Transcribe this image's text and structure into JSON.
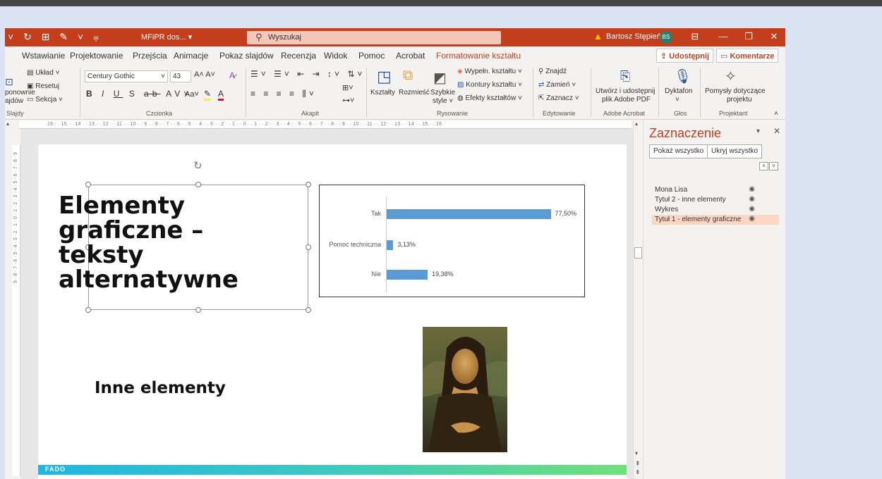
{
  "titlebar": {
    "doc_name": "MFiPR dos... ▾",
    "search_placeholder": "Wyszukaj",
    "user_name": "Bartosz Stępień",
    "avatar_initials": "BS"
  },
  "menu": {
    "items": [
      "Wstawianie",
      "Projektowanie",
      "Przejścia",
      "Animacje",
      "Pokaz slajdów",
      "Recenzja",
      "Widok",
      "Pomoc",
      "Acrobat",
      "Formatowanie kształtu"
    ],
    "share": "Udostępnij",
    "comments": "Komentarze"
  },
  "ribbon": {
    "slides": {
      "layout": "Układ ˅",
      "reset": "Resetuj",
      "section": "Sekcja ˅",
      "reuse1": "ponownie",
      "reuse2": "ajdów",
      "label": "Slajdy"
    },
    "font": {
      "name": "Century Gothic",
      "size": "43",
      "label": "Czcionka",
      "size_btns": "A˄ A˅",
      "case": "Aa˅"
    },
    "paragraph": {
      "label": "Akapit"
    },
    "drawing": {
      "shapes": "Kształty",
      "arrange": "Rozmieść",
      "quick1": "Szybkie",
      "quick2": "style ˅",
      "fill": "Wypełn. kształtu ˅",
      "outline": "Kontury kształtu ˅",
      "effects": "Efekty kształtów ˅",
      "label": "Rysowanie"
    },
    "editing": {
      "find": "Znajdź",
      "replace": "Zamień ˅",
      "select": "Zaznacz ˅",
      "label": "Edytowanie"
    },
    "acrobat": {
      "create1": "Utwórz i udostępnij",
      "create2": "plik Adobe PDF",
      "label": "Adobe Acrobat"
    },
    "voice": {
      "dictate": "Dyktafon",
      "label": "Głos"
    },
    "designer": {
      "ideas1": "Pomysły dotyczące",
      "ideas2": "projektu",
      "label": "Projektant"
    }
  },
  "ruler": {
    "horizontal": "16 · · 15 · · 14 · · 13 · · 12 · · 11 · · 10 · · 9 · · 8 · · 7 · · 6 · · 5 · · 4 · · 3 · · 2 · · 1 · · 0 · · 1 · · 2 · · 3 · · 4 · · 5 · · 6 · · 7 · · 8 · · 9 · · 10 · · 11 · · 12 · · 13 · · 14 · · 15 · · 16"
  },
  "slide": {
    "title1": "Elementy graficzne – teksty alternatywne",
    "title2": "Inne elementy",
    "footer_logo": "FADO"
  },
  "chart_data": {
    "type": "bar",
    "orientation": "horizontal",
    "categories": [
      "Tak",
      "Pomoc techniczna",
      "Nie"
    ],
    "values": [
      77.5,
      3.13,
      19.38
    ],
    "data_labels": [
      "77,50%",
      "3,13%",
      "19,38%"
    ],
    "xlim": [
      0,
      100
    ],
    "color": "#5b9bd5"
  },
  "selection_pane": {
    "title": "Zaznaczenie",
    "show_all": "Pokaż wszystko",
    "hide_all": "Ukryj wszystko",
    "items": [
      {
        "label": "Mona Lisa",
        "selected": false
      },
      {
        "label": "Tytuł 2 - inne elementy",
        "selected": false
      },
      {
        "label": "Wykres",
        "selected": false
      },
      {
        "label": "Tytuł 1 - elementy graficzne",
        "selected": true
      }
    ]
  },
  "colors": {
    "accent": "#c43e1c",
    "bar": "#5b9bd5"
  }
}
